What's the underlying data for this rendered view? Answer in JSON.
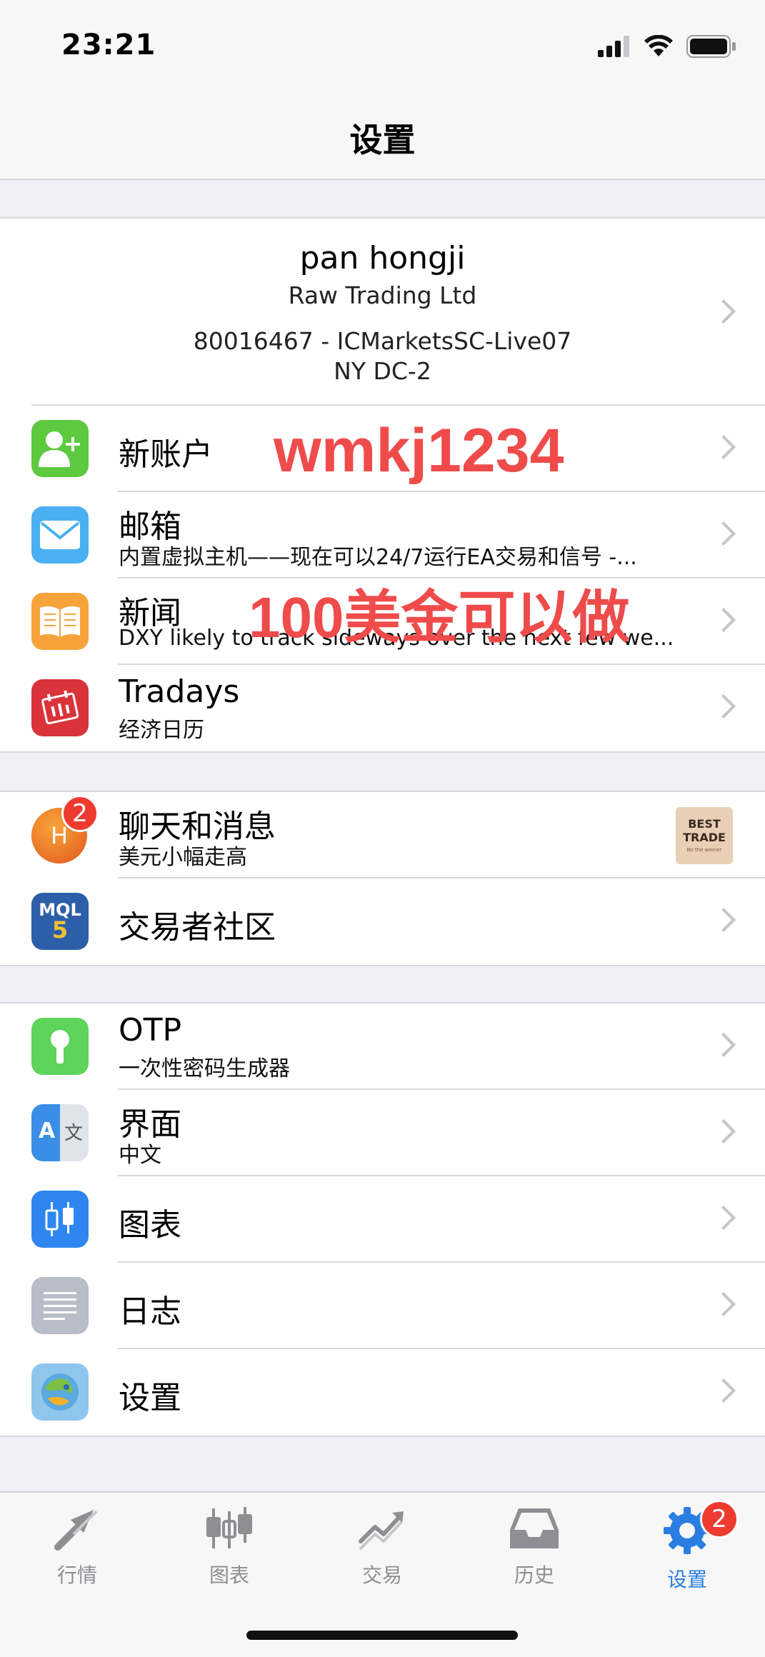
{
  "status": {
    "time": "23:21"
  },
  "header": {
    "title": "设置"
  },
  "account": {
    "name": "pan hongji",
    "company": "Raw Trading Ltd",
    "login": "80016467 - ICMarketsSC-Live07",
    "server": "NY DC-2"
  },
  "rows": {
    "new_account": {
      "title": "新账户"
    },
    "mailbox": {
      "title": "邮箱",
      "subtitle": "内置虚拟主机——现在可以24/7运行EA交易和信号 -..."
    },
    "news": {
      "title": "新闻",
      "subtitle": "DXY likely to track sideways over the next few we..."
    },
    "tradays": {
      "title": "Tradays",
      "subtitle": "经济日历"
    },
    "chat": {
      "title": "聊天和消息",
      "subtitle": "美元小幅走高",
      "avatar_letter": "H",
      "badge": "2",
      "thumb_line1": "BEST",
      "thumb_line2": "TRADE",
      "thumb_line3": "Be the winner"
    },
    "community": {
      "title": "交易者社区",
      "icon_text_top": "MQL",
      "icon_text_bottom": "5"
    },
    "otp": {
      "title": "OTP",
      "subtitle": "一次性密码生成器"
    },
    "interface": {
      "title": "界面",
      "subtitle": "中文",
      "icon_a": "A",
      "icon_wen": "文"
    },
    "charts": {
      "title": "图表"
    },
    "journal": {
      "title": "日志"
    },
    "settings": {
      "title": "设置"
    }
  },
  "watermarks": {
    "line1": "wmkj1234",
    "line2": "100美金可以做"
  },
  "tabs": [
    {
      "label": "行情"
    },
    {
      "label": "图表"
    },
    {
      "label": "交易"
    },
    {
      "label": "历史"
    },
    {
      "label": "设置",
      "badge": "2"
    }
  ],
  "colors": {
    "accent": "#2a7de1",
    "badge": "#ee3b30",
    "watermark": "#ef4b4b"
  }
}
